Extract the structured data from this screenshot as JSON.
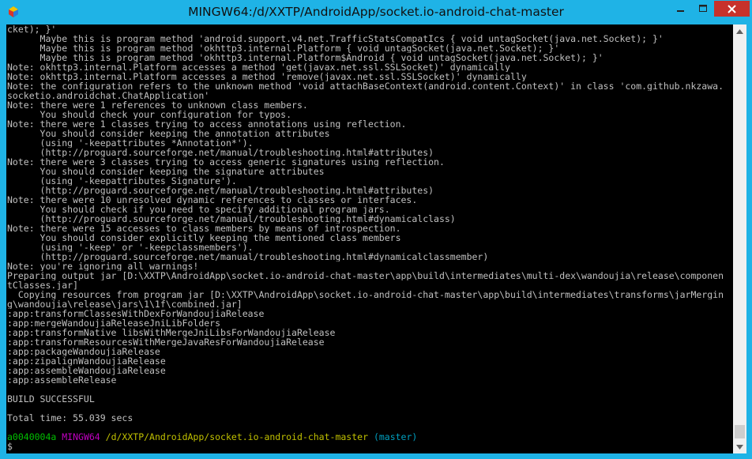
{
  "window": {
    "title": "MINGW64:/d/XXTP/AndroidApp/socket.io-android-chat-master"
  },
  "icons": {
    "app": "mingw-icon",
    "minimize": "minimize-icon",
    "maximize": "maximize-icon",
    "close": "close-icon",
    "scroll_up": "scroll-up-arrow-icon",
    "scroll_down": "scroll-down-arrow-icon"
  },
  "colors": {
    "title_bar": "#1fb3e6",
    "close_button": "#c7322b",
    "terminal_bg": "#000000",
    "terminal_text": "#c0c0c0",
    "prompt_user": "#00c000",
    "prompt_host": "#c000c0",
    "prompt_path": "#c0c000",
    "prompt_branch": "#00a0c0"
  },
  "terminal": {
    "lines": [
      "cket); }'",
      "      Maybe this is program method 'android.support.v4.net.TrafficStatsCompatIcs { void untagSocket(java.net.Socket); }'",
      "      Maybe this is program method 'okhttp3.internal.Platform { void untagSocket(java.net.Socket); }'",
      "      Maybe this is program method 'okhttp3.internal.Platform$Android { void untagSocket(java.net.Socket); }'",
      "Note: okhttp3.internal.Platform accesses a method 'get(javax.net.ssl.SSLSocket)' dynamically",
      "Note: okhttp3.internal.Platform accesses a method 'remove(javax.net.ssl.SSLSocket)' dynamically",
      "Note: the configuration refers to the unknown method 'void attachBaseContext(android.content.Context)' in class 'com.github.nkzawa.",
      "socketio.androidchat.ChatApplication'",
      "Note: there were 1 references to unknown class members.",
      "      You should check your configuration for typos.",
      "Note: there were 1 classes trying to access annotations using reflection.",
      "      You should consider keeping the annotation attributes",
      "      (using '-keepattributes *Annotation*').",
      "      (http://proguard.sourceforge.net/manual/troubleshooting.html#attributes)",
      "Note: there were 3 classes trying to access generic signatures using reflection.",
      "      You should consider keeping the signature attributes",
      "      (using '-keepattributes Signature').",
      "      (http://proguard.sourceforge.net/manual/troubleshooting.html#attributes)",
      "Note: there were 10 unresolved dynamic references to classes or interfaces.",
      "      You should check if you need to specify additional program jars.",
      "      (http://proguard.sourceforge.net/manual/troubleshooting.html#dynamicalclass)",
      "Note: there were 15 accesses to class members by means of introspection.",
      "      You should consider explicitly keeping the mentioned class members",
      "      (using '-keep' or '-keepclassmembers').",
      "      (http://proguard.sourceforge.net/manual/troubleshooting.html#dynamicalclassmember)",
      "Note: you're ignoring all warnings!",
      "Preparing output jar [D:\\XXTP\\AndroidApp\\socket.io-android-chat-master\\app\\build\\intermediates\\multi-dex\\wandoujia\\release\\componen",
      "tClasses.jar]",
      "  Copying resources from program jar [D:\\XXTP\\AndroidApp\\socket.io-android-chat-master\\app\\build\\intermediates\\transforms\\jarMergin",
      "g\\wandoujia\\release\\jars\\1\\1f\\combined.jar]",
      ":app:transformClassesWithDexForWandoujiaRelease",
      ":app:mergeWandoujiaReleaseJniLibFolders",
      ":app:transformNative_libsWithMergeJniLibsForWandoujiaRelease",
      ":app:transformResourcesWithMergeJavaResForWandoujiaRelease",
      ":app:packageWandoujiaRelease",
      ":app:zipalignWandoujiaRelease",
      ":app:assembleWandoujiaRelease",
      ":app:assembleRelease",
      "",
      "BUILD SUCCESSFUL",
      "",
      "Total time: 55.039 secs",
      ""
    ],
    "prompt": {
      "user": "a0040004a",
      "host": "MINGW64",
      "path": "/d/XXTP/AndroidApp/socket.io-android-chat-master",
      "branch": "(master)",
      "symbol": "$"
    }
  }
}
